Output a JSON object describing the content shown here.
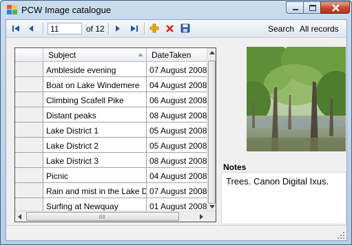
{
  "window": {
    "title": "PCW Image catalogue"
  },
  "navigator": {
    "position": "11",
    "count_label": "of 12",
    "search_label": "Search",
    "all_records_label": "All records"
  },
  "grid": {
    "columns": [
      "Subject",
      "DateTaken"
    ],
    "rows": [
      {
        "subject": "Ambleside evening",
        "date": "07 August 2008"
      },
      {
        "subject": "Boat on Lake Windemere",
        "date": "04 August 2008"
      },
      {
        "subject": "Climbing Scafell Pike",
        "date": "06 August 2008"
      },
      {
        "subject": "Distant peaks",
        "date": "08 August 2008"
      },
      {
        "subject": "Lake District 1",
        "date": "05 August 2008"
      },
      {
        "subject": "Lake District 2",
        "date": "05 August 2008"
      },
      {
        "subject": "Lake District 3",
        "date": "08 August 2008"
      },
      {
        "subject": "Picnic",
        "date": "04 August 2008"
      },
      {
        "subject": "Rain and mist in the Lake Di...",
        "date": "07 August 2008"
      },
      {
        "subject": "Surfing at Newquay",
        "date": "01 August 2008"
      }
    ]
  },
  "notes": {
    "label": "Notes",
    "text": "Trees. Canon Digital Ixus."
  },
  "colors": {
    "delete": "#e0231b",
    "add": "#f2b10f",
    "nav": "#2453a8"
  }
}
